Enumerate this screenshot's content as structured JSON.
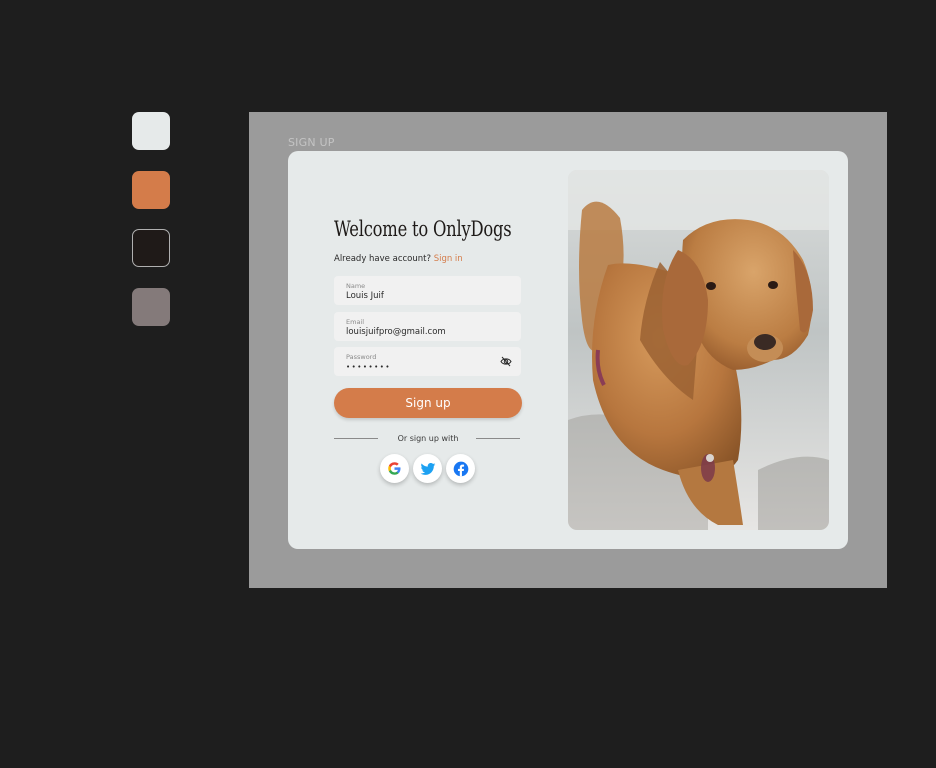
{
  "palette": [
    {
      "name": "light-gray",
      "color": "#e6eaea"
    },
    {
      "name": "orange",
      "color": "#d47c4a"
    },
    {
      "name": "near-black",
      "color": "#1f1a18"
    },
    {
      "name": "taupe",
      "color": "#847a7a"
    }
  ],
  "frame": {
    "label": "SIGN UP"
  },
  "form": {
    "title": "Welcome to OnlyDogs",
    "already_text": "Already have account?",
    "signin_link": "Sign in",
    "fields": {
      "name": {
        "label": "Name",
        "value": "Louis Juif"
      },
      "email": {
        "label": "Email",
        "value": "louisjuifpro@gmail.com"
      },
      "password": {
        "label": "Password",
        "value": "••••••••"
      }
    },
    "submit_label": "Sign up",
    "divider_text": "Or sign up with",
    "socials": [
      "google-icon",
      "twitter-icon",
      "facebook-icon"
    ]
  },
  "image": {
    "subject": "dog-photo"
  }
}
